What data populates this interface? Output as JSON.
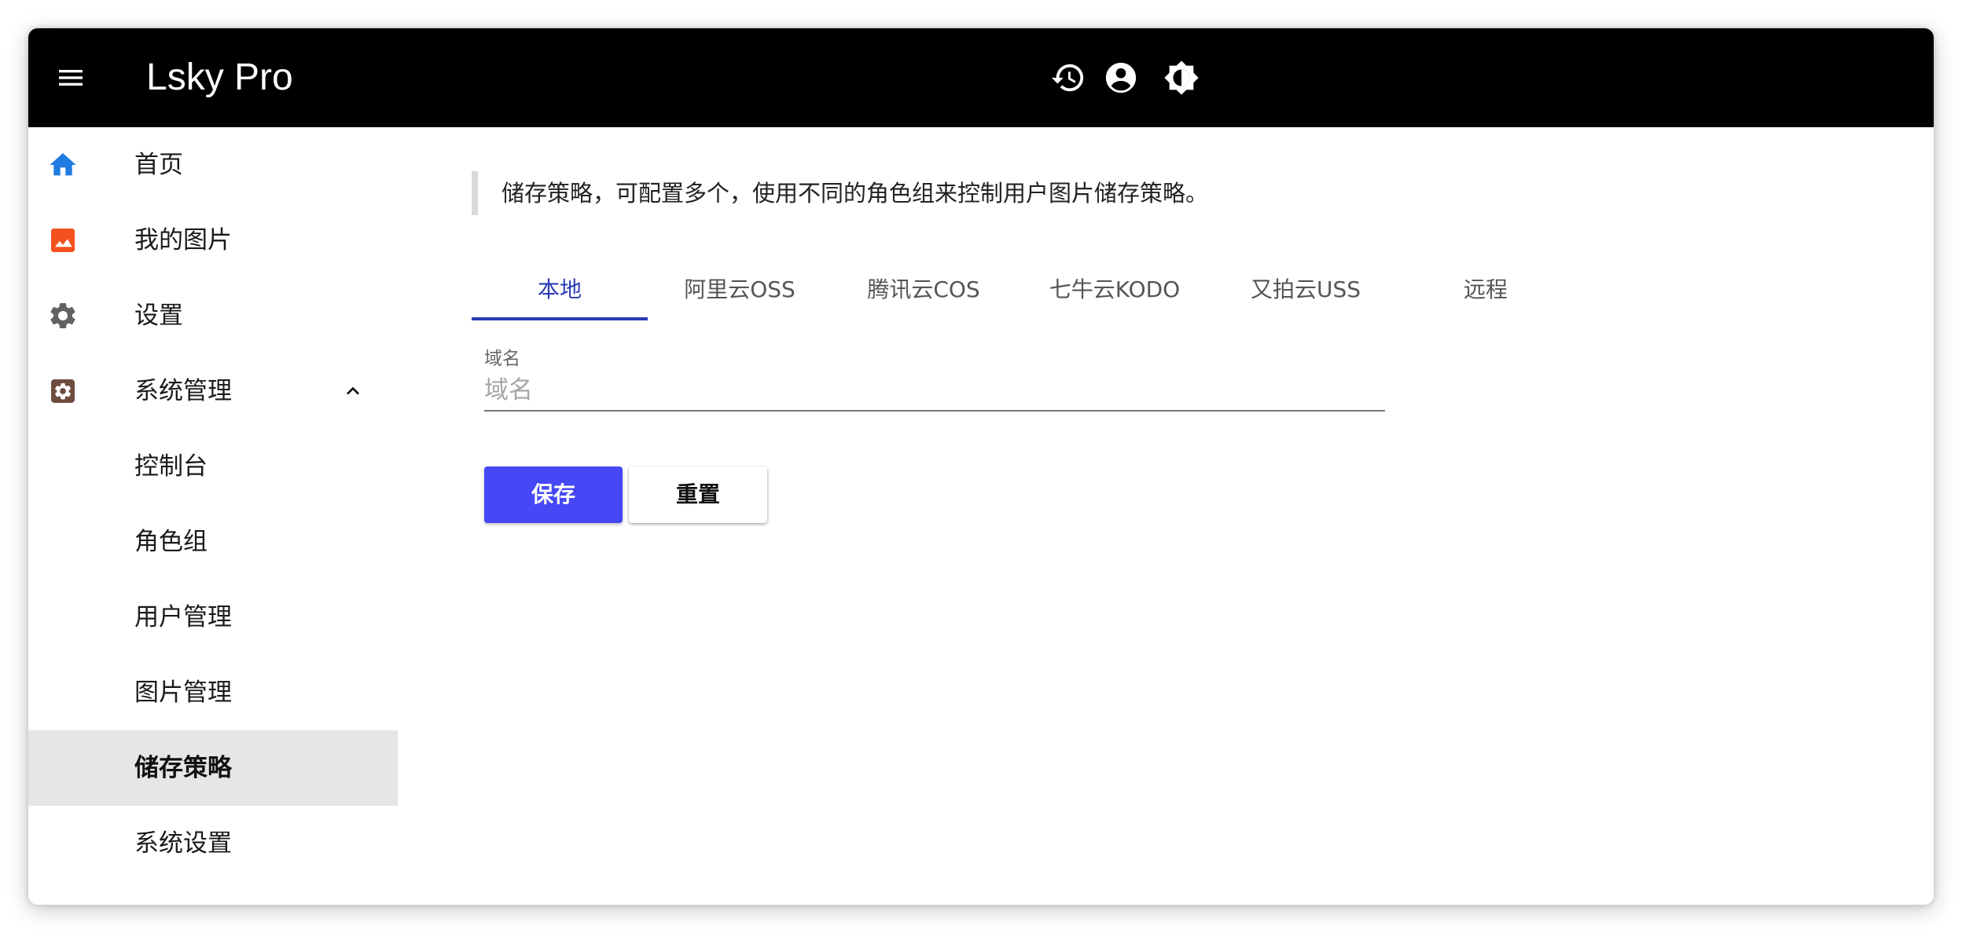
{
  "header": {
    "title": "Lsky Pro",
    "icons": [
      "menu-icon",
      "history-icon",
      "account-circle-icon",
      "brightness-icon"
    ]
  },
  "sidebar": {
    "items": [
      {
        "label": "首页",
        "icon": "home-icon",
        "icon_color": "#1e7be0"
      },
      {
        "label": "我的图片",
        "icon": "image-icon",
        "icon_color": "#f4511e"
      },
      {
        "label": "设置",
        "icon": "gear-icon",
        "icon_color": "#616161"
      },
      {
        "label": "系统管理",
        "icon": "admin-settings-icon",
        "icon_color": "#6d4c41",
        "expanded": true
      },
      {
        "label": "控制台"
      },
      {
        "label": "角色组"
      },
      {
        "label": "用户管理"
      },
      {
        "label": "图片管理"
      },
      {
        "label": "储存策略",
        "active": true
      },
      {
        "label": "系统设置"
      }
    ]
  },
  "main": {
    "notice": "储存策略，可配置多个，使用不同的角色组来控制用户图片储存策略。",
    "tabs": [
      {
        "label": "本地",
        "active": true
      },
      {
        "label": "阿里云OSS"
      },
      {
        "label": "腾讯云COS"
      },
      {
        "label": "七牛云KODO"
      },
      {
        "label": "又拍云USS"
      },
      {
        "label": "远程"
      }
    ],
    "form": {
      "domain_label": "域名",
      "domain_placeholder": "域名",
      "domain_value": ""
    },
    "buttons": {
      "save_label": "保存",
      "reset_label": "重置"
    }
  },
  "colors": {
    "appbar": "#000000",
    "accent": "#2a3bb3",
    "primary_button": "#4648f5",
    "active_nav_bg": "#e6e6e6"
  }
}
